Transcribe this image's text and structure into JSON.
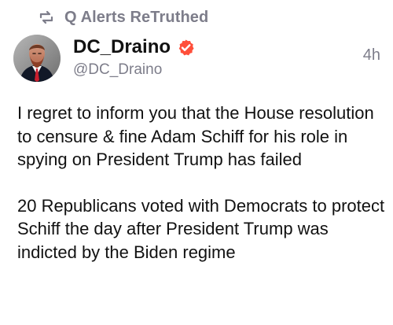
{
  "post": {
    "retruth_label": "Q Alerts ReTruthed",
    "author": {
      "display_name": "DC_Draino",
      "handle": "@DC_Draino",
      "verified": true
    },
    "timestamp": "4h",
    "paragraphs": [
      "I regret to inform you that the House resolution to censure & fine Adam Schiff for his role in spying on President Trump has failed",
      "20 Republicans voted with Democrats to protect Schiff the day after President Trump was indicted by the Biden regime"
    ]
  },
  "colors": {
    "text": "#111111",
    "muted": "#7d7d8a",
    "verified_badge": "#ff4f3a",
    "background": "#ffffff"
  },
  "icons": {
    "retruth": "retruth-icon",
    "verified": "verified-icon",
    "avatar": "avatar-image"
  }
}
